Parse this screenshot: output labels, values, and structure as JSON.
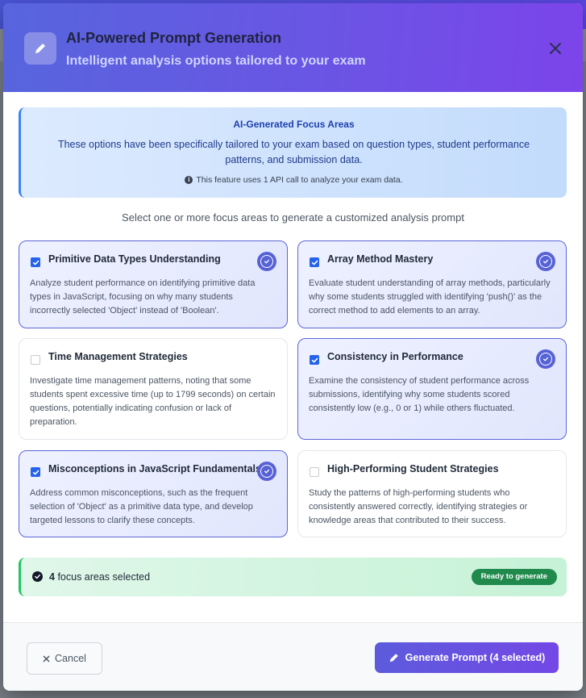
{
  "header": {
    "title": "AI-Powered Prompt Generation",
    "subtitle": "Intelligent analysis options tailored to your exam",
    "icon": "pencil-icon",
    "close_icon": "close-icon"
  },
  "info": {
    "title": "AI-Generated Focus Areas",
    "description": "These options have been specifically tailored to your exam based on question types, student performance patterns, and submission data.",
    "note": "This feature uses 1 API call to analyze your exam data."
  },
  "instruction": "Select one or more focus areas to generate a customized analysis prompt",
  "cards": [
    {
      "title": "Primitive Data Types Understanding",
      "description": "Analyze student performance on identifying primitive data types in JavaScript, focusing on why many students incorrectly selected 'Object' instead of 'Boolean'.",
      "selected": true
    },
    {
      "title": "Array Method Mastery",
      "description": "Evaluate student understanding of array methods, particularly why some students struggled with identifying 'push()' as the correct method to add elements to an array.",
      "selected": true
    },
    {
      "title": "Time Management Strategies",
      "description": "Investigate time management patterns, noting that some students spent excessive time (up to 1799 seconds) on certain questions, potentially indicating confusion or lack of preparation.",
      "selected": false
    },
    {
      "title": "Consistency in Performance",
      "description": "Examine the consistency of student performance across submissions, identifying why some students scored consistently low (e.g., 0 or 1) while others fluctuated.",
      "selected": true
    },
    {
      "title": "Misconceptions in JavaScript Fundamentals",
      "description": "Address common misconceptions, such as the frequent selection of 'Object' as a primitive data type, and develop targeted lessons to clarify these concepts.",
      "selected": true
    },
    {
      "title": "High-Performing Student Strategies",
      "description": "Study the patterns of high-performing students who consistently answered correctly, identifying strategies or knowledge areas that contributed to their success.",
      "selected": false
    }
  ],
  "status": {
    "count": "4",
    "text": "focus areas selected",
    "badge": "Ready to generate"
  },
  "footer": {
    "cancel_label": "Cancel",
    "generate_label": "Generate Prompt (4 selected)"
  },
  "colors": {
    "accent": "#5762d5",
    "header_start": "#5765dd",
    "header_end": "#7c44ea",
    "success": "#1f8a4c"
  }
}
